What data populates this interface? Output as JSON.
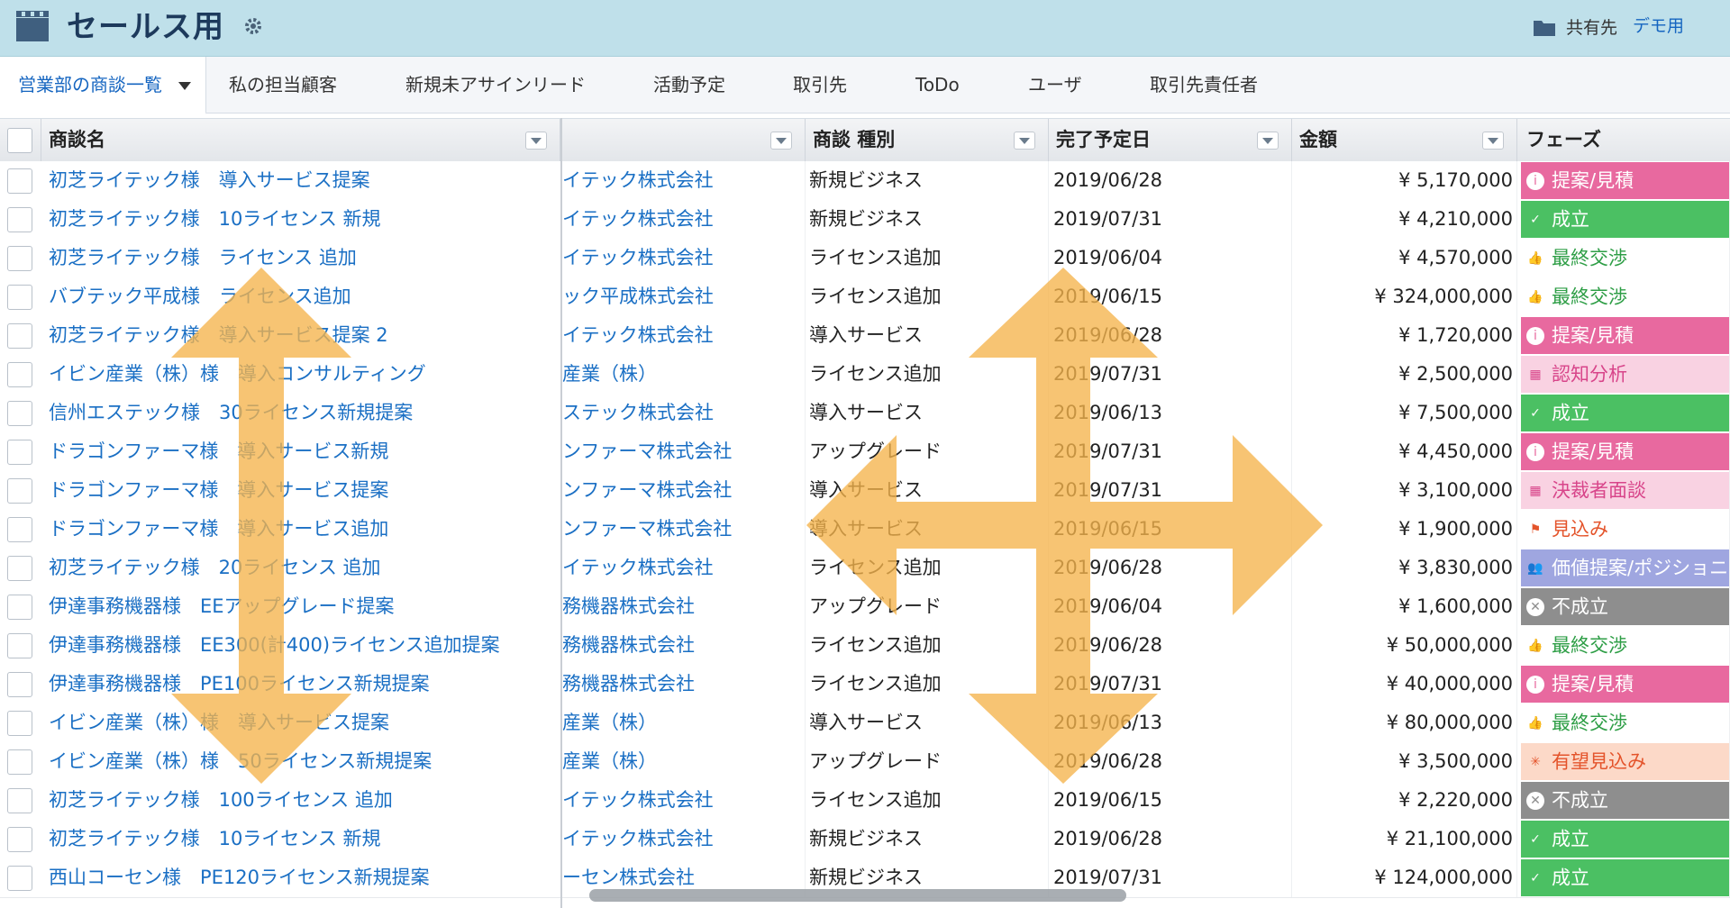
{
  "header": {
    "title": "セールス用",
    "share_label": "共有先",
    "demo_label": "デモ用"
  },
  "tabs": [
    {
      "label": "営業部の商談一覧",
      "active": true
    },
    {
      "label": "私の担当顧客"
    },
    {
      "label": "新規未アサインリード"
    },
    {
      "label": "活動予定"
    },
    {
      "label": "取引先"
    },
    {
      "label": "ToDo"
    },
    {
      "label": "ユーザ"
    },
    {
      "label": "取引先責任者"
    }
  ],
  "columns": {
    "name": "商談名",
    "account": "",
    "type": "商談 種別",
    "date": "完了予定日",
    "amount": "金額",
    "phase": "フェーズ"
  },
  "phase_styles": {
    "提案/見積": {
      "bg": "#e8699f",
      "fg": "#ffffff",
      "icon": "info-icon"
    },
    "成立": {
      "bg": "#4bc063",
      "fg": "#ffffff",
      "icon": "check-icon"
    },
    "最終交渉": {
      "bg": "#ffffff",
      "fg": "#2e9e46",
      "icon": "thumbs-up-icon"
    },
    "認知分析": {
      "bg": "#f9d2e2",
      "fg": "#d8458a",
      "icon": "grid-icon"
    },
    "決裁者面談": {
      "bg": "#f9d2e2",
      "fg": "#d8458a",
      "icon": "grid-icon"
    },
    "見込み": {
      "bg": "#ffffff",
      "fg": "#e4542b",
      "icon": "flag-icon"
    },
    "価値提案/ポジショニング": {
      "bg": "#9fa6e0",
      "fg": "#ffffff",
      "icon": "people-icon"
    },
    "不成立": {
      "bg": "#8e8e8e",
      "fg": "#ffffff",
      "icon": "x-icon"
    },
    "有望見込み": {
      "bg": "#fcd9c8",
      "fg": "#e4542b",
      "icon": "spark-icon"
    }
  },
  "rows": [
    {
      "name": "初芝ライテック様　導入サービス提案",
      "account": "イテック株式会社",
      "type": "新規ビジネス",
      "date": "2019/06/28",
      "amount": "¥ 5,170,000",
      "phase": "提案/見積"
    },
    {
      "name": "初芝ライテック様　10ライセンス 新規",
      "account": "イテック株式会社",
      "type": "新規ビジネス",
      "date": "2019/07/31",
      "amount": "¥ 4,210,000",
      "phase": "成立"
    },
    {
      "name": "初芝ライテック様　ライセンス 追加",
      "account": "イテック株式会社",
      "type": "ライセンス追加",
      "date": "2019/06/04",
      "amount": "¥ 4,570,000",
      "phase": "最終交渉"
    },
    {
      "name": "バブテック平成様　ライセンス追加",
      "account": "ック平成株式会社",
      "type": "ライセンス追加",
      "date": "2019/06/15",
      "amount": "¥ 324,000,000",
      "phase": "最終交渉"
    },
    {
      "name": "初芝ライテック様　導入サービス提案 2",
      "account": "イテック株式会社",
      "type": "導入サービス",
      "date": "2019/06/28",
      "amount": "¥ 1,720,000",
      "phase": "提案/見積"
    },
    {
      "name": "イビン産業（株）様　導入コンサルティング",
      "account": "産業（株）",
      "type": "ライセンス追加",
      "date": "2019/07/31",
      "amount": "¥ 2,500,000",
      "phase": "認知分析"
    },
    {
      "name": "信州エステック様　30ライセンス新規提案",
      "account": "ステック株式会社",
      "type": "導入サービス",
      "date": "2019/06/13",
      "amount": "¥ 7,500,000",
      "phase": "成立"
    },
    {
      "name": "ドラゴンファーマ様　導入サービス新規",
      "account": "ンファーマ株式会社",
      "type": "アップグレード",
      "date": "2019/07/31",
      "amount": "¥ 4,450,000",
      "phase": "提案/見積"
    },
    {
      "name": "ドラゴンファーマ様　導入サービス提案",
      "account": "ンファーマ株式会社",
      "type": "導入サービス",
      "date": "2019/07/31",
      "amount": "¥ 3,100,000",
      "phase": "決裁者面談"
    },
    {
      "name": "ドラゴンファーマ様　導入サービス追加",
      "account": "ンファーマ株式会社",
      "type": "導入サービス",
      "date": "2019/06/15",
      "amount": "¥ 1,900,000",
      "phase": "見込み"
    },
    {
      "name": "初芝ライテック様　20ライセンス 追加",
      "account": "イテック株式会社",
      "type": "ライセンス追加",
      "date": "2019/06/28",
      "amount": "¥ 3,830,000",
      "phase": "価値提案/ポジショニング"
    },
    {
      "name": "伊達事務機器様　EEアップグレード提案",
      "account": "務機器株式会社",
      "type": "アップグレード",
      "date": "2019/06/04",
      "amount": "¥ 1,600,000",
      "phase": "不成立"
    },
    {
      "name": "伊達事務機器様　EE300(計400)ライセンス追加提案",
      "account": "務機器株式会社",
      "type": "ライセンス追加",
      "date": "2019/06/28",
      "amount": "¥ 50,000,000",
      "phase": "最終交渉"
    },
    {
      "name": "伊達事務機器様　PE100ライセンス新規提案",
      "account": "務機器株式会社",
      "type": "ライセンス追加",
      "date": "2019/07/31",
      "amount": "¥ 40,000,000",
      "phase": "提案/見積"
    },
    {
      "name": "イビン産業（株）様　導入サービス提案",
      "account": "産業（株）",
      "type": "導入サービス",
      "date": "2019/06/13",
      "amount": "¥ 80,000,000",
      "phase": "最終交渉"
    },
    {
      "name": "イビン産業（株）様　50ライセンス新規提案",
      "account": "産業（株）",
      "type": "アップグレード",
      "date": "2019/06/28",
      "amount": "¥ 3,500,000",
      "phase": "有望見込み"
    },
    {
      "name": "初芝ライテック様　100ライセンス 追加",
      "account": "イテック株式会社",
      "type": "ライセンス追加",
      "date": "2019/06/15",
      "amount": "¥ 2,220,000",
      "phase": "不成立"
    },
    {
      "name": "初芝ライテック様　10ライセンス 新規",
      "account": "イテック株式会社",
      "type": "新規ビジネス",
      "date": "2019/06/28",
      "amount": "¥ 21,100,000",
      "phase": "成立"
    },
    {
      "name": "西山コーセン様　PE120ライセンス新規提案",
      "account": "ーセン株式会社",
      "type": "新規ビジネス",
      "date": "2019/07/31",
      "amount": "¥ 124,000,000",
      "phase": "成立"
    }
  ]
}
